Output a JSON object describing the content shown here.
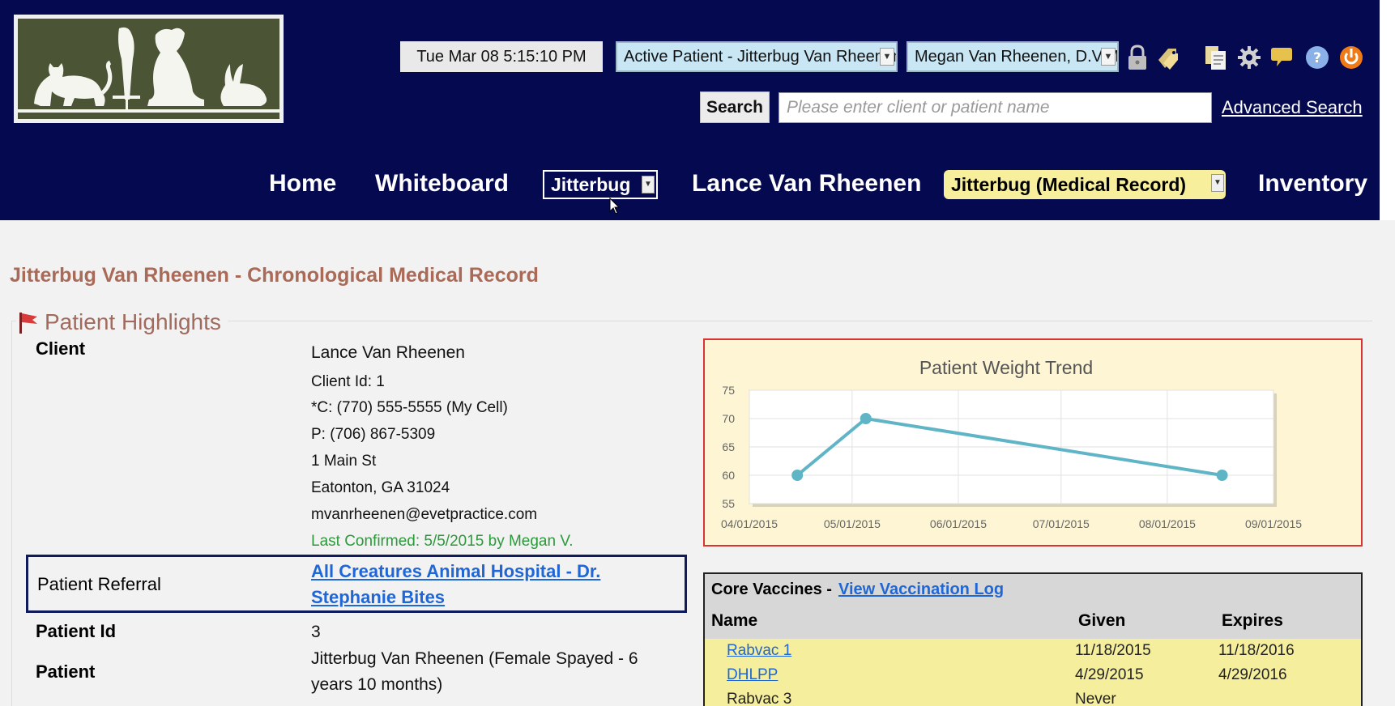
{
  "header": {
    "clock": "Tue Mar 08 5:15:10 PM",
    "active_patient_select": "Active Patient - Jitterbug Van Rheenen",
    "user_select": "Megan Van Rheenen, D.V.M.",
    "search_button": "Search",
    "search_placeholder": "Please enter client or patient name",
    "advanced_search": "Advanced Search",
    "icons": [
      "lock-icon",
      "tags-icon",
      "documents-icon",
      "gear-icon",
      "chat-icon",
      "help-icon",
      "power-icon"
    ]
  },
  "nav": {
    "home": "Home",
    "whiteboard": "Whiteboard",
    "jitterbug": "Jitterbug",
    "client": "Lance Van Rheenen",
    "medical_record": "Jitterbug (Medical Record)",
    "inventory": "Inventory"
  },
  "page": {
    "title": "Jitterbug Van Rheenen - Chronological Medical Record",
    "highlights_title": "Patient Highlights"
  },
  "client": {
    "label": "Client",
    "name": "Lance Van Rheenen",
    "client_id": "Client Id: 1",
    "cell": "*C: (770) 555-5555 (My Cell)",
    "phone": "P: (706) 867-5309",
    "street": "1 Main St",
    "city": "Eatonton, GA 31024",
    "email": "mvanrheenen@evetpractice.com",
    "confirmed": "Last Confirmed: 5/5/2015 by Megan V."
  },
  "referral": {
    "label": "Patient Referral",
    "line1": "All Creatures Animal Hospital - Dr.",
    "line2": "Stephanie Bites"
  },
  "patient": {
    "id_label": "Patient Id",
    "id_value": "3",
    "label": "Patient",
    "line1": "Jitterbug Van Rheenen (Female Spayed - 6",
    "line2": "years 10 months)"
  },
  "chart_data": {
    "type": "line",
    "title": "Patient Weight Trend",
    "x_ticks": [
      "04/01/2015",
      "05/01/2015",
      "06/01/2015",
      "07/01/2015",
      "08/01/2015",
      "09/01/2015"
    ],
    "y_ticks": [
      55,
      60,
      65,
      70,
      75
    ],
    "ylim": [
      55,
      75
    ],
    "xlim": [
      "04/01/2015",
      "09/01/2015"
    ],
    "grid": true,
    "series": [
      {
        "x": [
          "04/15/2015",
          "05/05/2015",
          "08/17/2015"
        ],
        "y": [
          60,
          70,
          60
        ]
      }
    ],
    "line_color": "#5fb5c6",
    "plot_background": "#ffffff",
    "panel_background": "#fdf5d4",
    "border_color": "#d83434"
  },
  "vaccines": {
    "header": "Core Vaccines -",
    "log_link": "View Vaccination Log",
    "col_name": "Name",
    "col_given": "Given",
    "col_expires": "Expires",
    "rows": [
      {
        "name": "Rabvac 1",
        "given": "11/18/2015",
        "expires": "11/18/2016",
        "link": true
      },
      {
        "name": "DHLPP",
        "given": "4/29/2015",
        "expires": "4/29/2016",
        "link": true
      },
      {
        "name": "Rabvac 3",
        "given": "Never",
        "expires": "",
        "link": false
      }
    ]
  }
}
